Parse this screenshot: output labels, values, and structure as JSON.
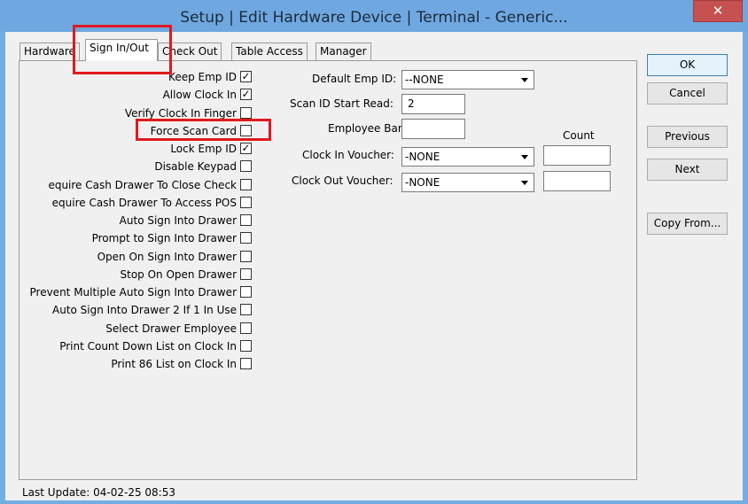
{
  "window": {
    "title": "Setup | Edit Hardware Device | Terminal - Generic...",
    "close_glyph": "✕"
  },
  "tabs": [
    {
      "label": "Hardware"
    },
    {
      "label": "Sign In/Out"
    },
    {
      "label": "Check Out"
    },
    {
      "label": "Table Access"
    },
    {
      "label": "Manager"
    }
  ],
  "checkboxes": [
    {
      "label": "Keep Emp ID",
      "checked": true
    },
    {
      "label": "Allow Clock In",
      "checked": true
    },
    {
      "label": "Verify Clock In Finger",
      "checked": false
    },
    {
      "label": "Force Scan Card",
      "checked": false
    },
    {
      "label": "Lock Emp ID",
      "checked": true
    },
    {
      "label": "Disable Keypad",
      "checked": false
    },
    {
      "label": "equire Cash Drawer To Close Check",
      "checked": false
    },
    {
      "label": "equire Cash Drawer To Access POS",
      "checked": false
    },
    {
      "label": "Auto Sign Into Drawer",
      "checked": false
    },
    {
      "label": "Prompt to Sign Into Drawer",
      "checked": false
    },
    {
      "label": "Open On Sign Into Drawer",
      "checked": false
    },
    {
      "label": "Stop On Open Drawer",
      "checked": false
    },
    {
      "label": "Prevent Multiple Auto Sign Into Drawer",
      "checked": false
    },
    {
      "label": "Auto Sign Into Drawer 2 If 1 In Use",
      "checked": false
    },
    {
      "label": "Select Drawer Employee",
      "checked": false
    },
    {
      "label": "Print Count Down List on Clock In",
      "checked": false
    },
    {
      "label": "Print 86 List on Clock In",
      "checked": false
    }
  ],
  "check_glyph": "✓",
  "fields": {
    "default_emp_id": {
      "label": "Default Emp ID:",
      "value": "--NONE"
    },
    "scan_id_start_read": {
      "label": "Scan ID Start Read:",
      "value": "2"
    },
    "employee_bank": {
      "label": "Employee Bank",
      "value": ""
    },
    "count_header": "Count",
    "clock_in_voucher": {
      "label": "Clock In Voucher:",
      "value": "-NONE",
      "count": ""
    },
    "clock_out_voucher": {
      "label": "Clock Out Voucher:",
      "value": "-NONE",
      "count": ""
    }
  },
  "buttons": {
    "ok": "OK",
    "cancel": "Cancel",
    "previous": "Previous",
    "next": "Next",
    "copy_from": "Copy From..."
  },
  "status": {
    "last_update": "Last Update:  04-02-25 08:53"
  },
  "colors": {
    "title_bar": "#6fa8e0",
    "close_button": "#c75050",
    "highlight": "#e0191e",
    "client_bg": "#f0f0f0"
  }
}
